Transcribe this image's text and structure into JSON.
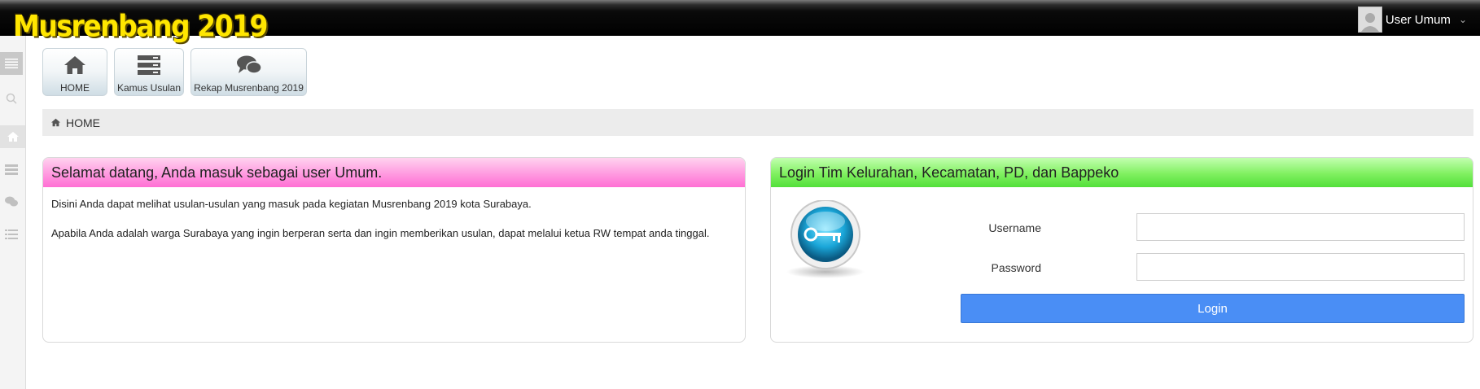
{
  "header": {
    "app_title": "Musrenbang 2019",
    "user_name": "User Umum"
  },
  "sidebar": {
    "items": [
      {
        "icon": "menu-toggle-icon"
      },
      {
        "icon": "search-icon"
      },
      {
        "icon": "home-icon"
      },
      {
        "icon": "list-icon"
      },
      {
        "icon": "comments-icon"
      },
      {
        "icon": "list-lines-icon"
      }
    ]
  },
  "shortcuts": [
    {
      "label": "HOME",
      "icon": "home-icon"
    },
    {
      "label": "Kamus Usulan",
      "icon": "server-icon"
    },
    {
      "label": "Rekap Musrenbang 2019",
      "icon": "comments-icon"
    }
  ],
  "breadcrumb": {
    "label": "HOME",
    "icon": "home-icon"
  },
  "welcome_panel": {
    "title": "Selamat datang, Anda masuk sebagai user Umum.",
    "paragraphs": [
      "Disini Anda dapat melihat usulan-usulan yang masuk pada kegiatan Musrenbang 2019 kota Surabaya.",
      "Apabila Anda adalah warga Surabaya yang ingin berperan serta dan ingin memberikan usulan, dapat melalui ketua RW tempat anda tinggal."
    ]
  },
  "login_panel": {
    "title": "Login Tim Kelurahan, Kecamatan, PD, dan Bappeko",
    "username_label": "Username",
    "username_value": "",
    "password_label": "Password",
    "password_value": "",
    "login_button": "Login"
  },
  "colors": {
    "brand_yellow": "#ffe600",
    "welcome_header": "#ff7fd8",
    "login_header": "#5ee343",
    "login_button": "#4a8ef5"
  }
}
